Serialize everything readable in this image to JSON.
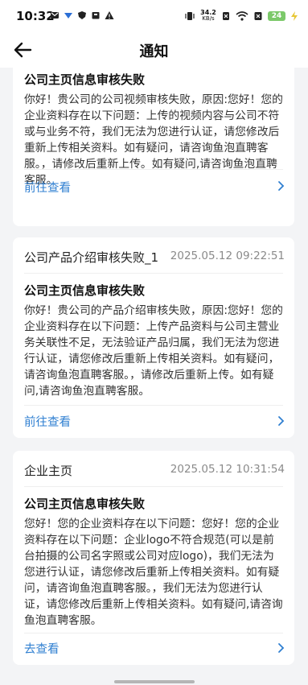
{
  "status_bar": {
    "time": "10:32",
    "net_speed_top": "34.2",
    "net_speed_unit": "KB/s",
    "battery": "24"
  },
  "header": {
    "title": "通知"
  },
  "cards": [
    {
      "type": "",
      "time": "",
      "title": "公司主页信息审核失败",
      "body": "你好！贵公司的公司视频审核失败，原因:您好！您的企业资料存在以下问题：上传的视频内容与公司不符或与业务不符，我们无法为您进行认证，请您修改后重新上传相关资料。如有疑问，请咨询鱼泡直聘客服。，请修改后重新上传。如有疑问,请咨询鱼泡直聘客服。",
      "link": "前往查看"
    },
    {
      "type": "公司产品介绍审核失败_1",
      "time": "2025.05.12 09:22:51",
      "title": "公司主页信息审核失败",
      "body": "你好！贵公司的产品介绍审核失败，原因:您好！您的企业资料存在以下问题：上传产品资料与公司主营业务关联性不足，无法验证产品归属，我们无法为您进行认证，请您修改后重新上传相关资料。如有疑问，请咨询鱼泡直聘客服。，请修改后重新上传。如有疑问,请咨询鱼泡直聘客服。",
      "link": "前往查看"
    },
    {
      "type": "企业主页",
      "time": "2025.05.12 10:31:54",
      "title": "公司主页信息审核失败",
      "body": "您好！您的企业资料存在以下问题：您好！您的企业资料存在以下问题：企业logo不符合规范(可以是前台拍摄的公司名字照或公司对应logo)，我们无法为您进行认证，请您修改后重新上传相关资料。如有疑问，请咨询鱼泡直聘客服。，我们无法为您进行认证，请您修改后重新上传相关资料。如有疑问,请咨询鱼泡直聘客服。",
      "link": "去查看"
    }
  ]
}
